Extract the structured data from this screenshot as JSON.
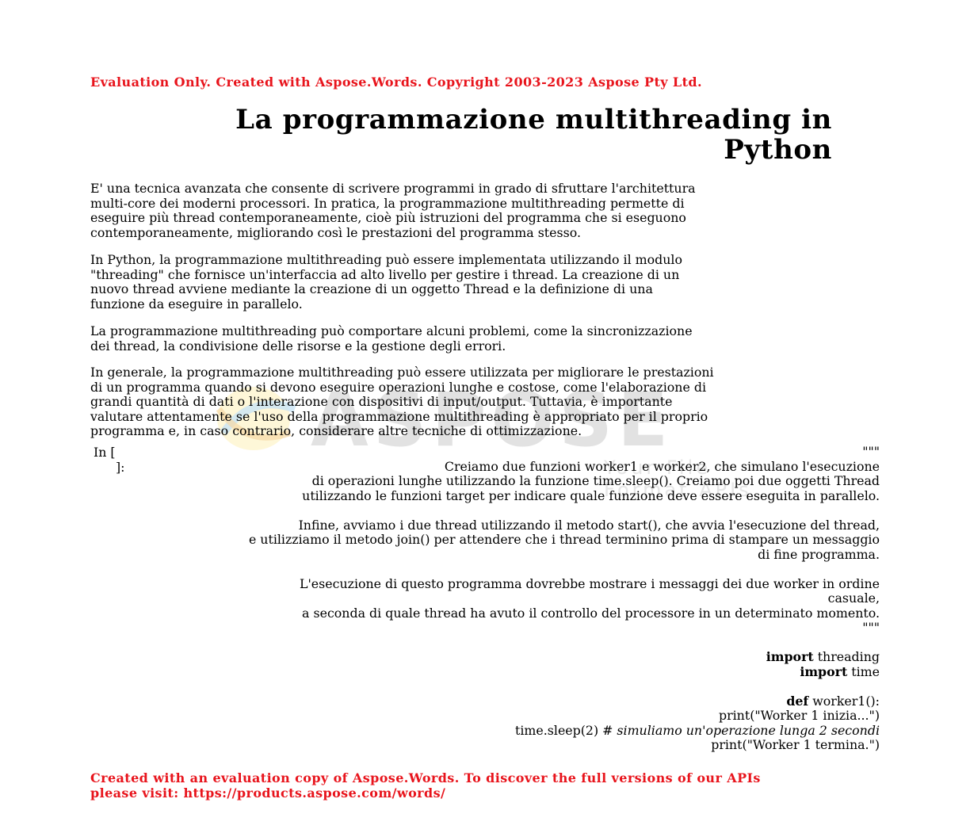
{
  "watermark": {
    "brand": "ASPOSE",
    "sub": "Your File Format APIs"
  },
  "header": {
    "eval_notice": "Evaluation Only. Created with Aspose.Words. Copyright 2003-2023 Aspose Pty Ltd."
  },
  "title": {
    "line1": "La programmazione multithreading in",
    "line2": "Python"
  },
  "paragraphs": [
    [
      "E' una tecnica avanzata che consente di scrivere programmi in grado di sfruttare l'architettura",
      "multi-core dei moderni processori. In pratica, la programmazione multithreading permette di",
      "eseguire più thread contemporaneamente, cioè più istruzioni del programma che si eseguono",
      "contemporaneamente, migliorando così le prestazioni del programma stesso."
    ],
    [
      "In Python, la programmazione multithreading può essere implementata utilizzando il modulo",
      "\"threading\" che fornisce un'interfaccia ad alto livello per gestire i thread. La creazione di un",
      "nuovo thread avviene mediante la creazione di un oggetto Thread e la definizione di una",
      "funzione da eseguire in parallelo."
    ],
    [
      "La programmazione multithreading può comportare alcuni problemi, come la sincronizzazione",
      "dei thread, la condivisione delle risorse e la gestione degli errori."
    ],
    [
      "In generale, la programmazione multithreading può essere utilizzata per migliorare le prestazioni",
      "di un programma quando si devono eseguire operazioni lunghe e costose, come l'elaborazione di",
      "grandi quantità di dati o l'interazione con dispositivi di input/output. Tuttavia, è importante",
      "valutare attentamente se l'uso della programmazione multithreading è appropriato per il proprio",
      "programma e, in caso contrario, considerare altre tecniche di ottimizzazione."
    ]
  ],
  "cell": {
    "prompt_line1": "In [",
    "prompt_line2": "]:",
    "docstring": {
      "open": "\"\"\"",
      "l1": "Creiamo due funzioni worker1 e worker2, che simulano l'esecuzione",
      "l2": "di operazioni lunghe utilizzando la funzione time.sleep(). Creiamo poi due oggetti Thread",
      "l3": "utilizzando le funzioni target per indicare quale funzione deve essere eseguita in parallelo.",
      "l4": "Infine, avviamo i due thread utilizzando il metodo start(), che avvia l'esecuzione del thread,",
      "l5": "e utilizziamo il metodo join() per attendere che i thread terminino prima di stampare un messaggio",
      "l6": "di fine programma.",
      "l7": "L'esecuzione di questo programma dovrebbe mostrare i messaggi dei due worker in ordine",
      "l8": "casuale,",
      "l9": "a seconda di quale thread ha avuto il controllo del processore in un determinato momento.",
      "close": "\"\"\""
    },
    "code": {
      "import_kw": "import",
      "import1_mod": " threading",
      "import2_mod": " time",
      "def_kw": "def",
      "def_sig": " worker1():",
      "print1": "print(\"Worker 1 inizia...\")",
      "sleep_call": "time.sleep(2)  ",
      "sleep_comment": "# simuliamo un'operazione lunga 2 secondi",
      "print2": "print(\"Worker 1 termina.\")"
    }
  },
  "footer": {
    "line1": "Created with an evaluation copy of Aspose.Words. To discover the full versions of our APIs",
    "line2": "please visit: https://products.aspose.com/words/"
  }
}
